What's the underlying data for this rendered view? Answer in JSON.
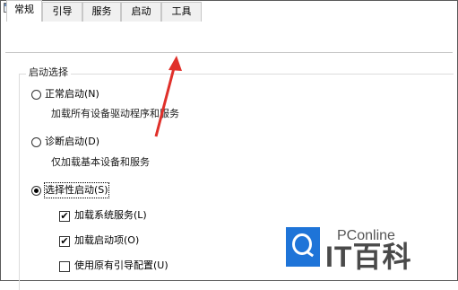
{
  "tabs": [
    {
      "label": "常规",
      "active": true
    },
    {
      "label": "引导",
      "active": false
    },
    {
      "label": "服务",
      "active": false
    },
    {
      "label": "启动",
      "active": false
    },
    {
      "label": "工具",
      "active": false
    }
  ],
  "startup_selection": {
    "group_label": "启动选择",
    "normal": {
      "label": "正常启动(N)",
      "description": "加载所有设备驱动程序和服务",
      "selected": false
    },
    "diagnostic": {
      "label": "诊断启动(D)",
      "description": "仅加载基本设备和服务",
      "selected": false
    },
    "selective": {
      "label": "选择性启动(S)",
      "selected": true
    },
    "options": [
      {
        "label": "加载系统服务(L)",
        "checked": true
      },
      {
        "label": "加载启动项(O)",
        "checked": true
      },
      {
        "label": "使用原有引导配置(U)",
        "checked": false
      }
    ]
  },
  "watermark": {
    "brand_small": "PConline",
    "brand_large": "IT百科",
    "color": "#1e74d8"
  },
  "annotation": {
    "type": "arrow",
    "points_to": "tab-tools",
    "color": "#e0302a"
  }
}
